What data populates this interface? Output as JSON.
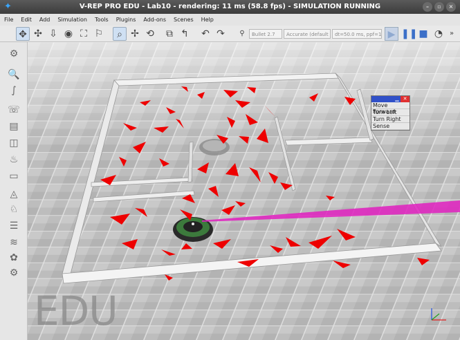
{
  "window": {
    "title": "V-REP PRO EDU - Lab10 - rendering: 11 ms (58.8 fps) - SIMULATION RUNNING",
    "app_icon": "vrep-logo-icon",
    "controls": [
      "minimize-icon",
      "maximize-icon",
      "close-icon"
    ]
  },
  "menubar": {
    "items": [
      {
        "label": "File"
      },
      {
        "label": "Edit"
      },
      {
        "label": "Add"
      },
      {
        "label": "Simulation"
      },
      {
        "label": "Tools"
      },
      {
        "label": "Plugins"
      },
      {
        "label": "Add-ons"
      },
      {
        "label": "Scenes"
      },
      {
        "label": "Help"
      }
    ]
  },
  "toolbar": {
    "engine": "Bullet 2.7",
    "accuracy": "Accurate (default",
    "timestep": "dt=50.0 ms, ppf=1",
    "overflow": "»"
  },
  "robot_menu": {
    "items": [
      {
        "label": "Move Forward"
      },
      {
        "label": "Turn Left"
      },
      {
        "label": "Turn Right"
      },
      {
        "label": "Sense"
      }
    ]
  },
  "watermark": "EDU",
  "colors": {
    "title_bg": "#4a4a4a",
    "laser": "#e020c0",
    "markers": "#ee0000",
    "menu_header": "#3050c8",
    "menu_close": "#e03030"
  }
}
